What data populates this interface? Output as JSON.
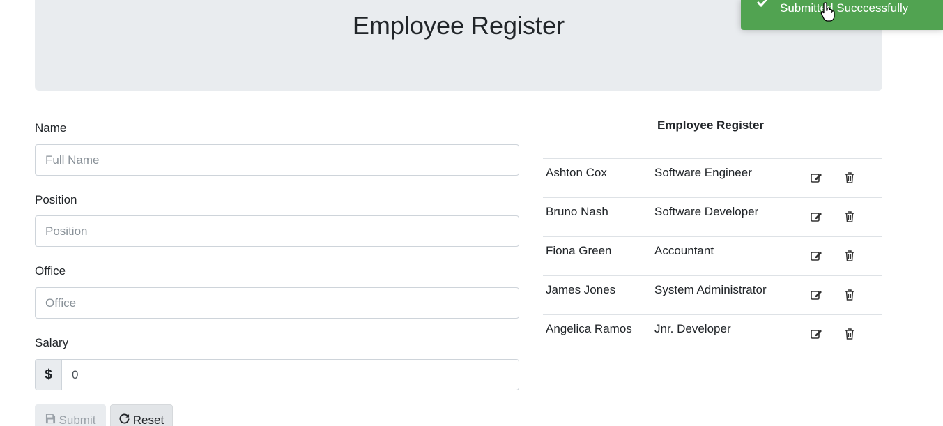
{
  "header": {
    "title": "Employee Register"
  },
  "form": {
    "name_label": "Name",
    "name_placeholder": "Full Name",
    "position_label": "Position",
    "position_placeholder": "Position",
    "office_label": "Office",
    "office_placeholder": "Office",
    "salary_label": "Salary",
    "salary_prefix": "$",
    "salary_value": "0",
    "submit_label": "Submit",
    "reset_label": "Reset"
  },
  "table": {
    "title": "Employee Register",
    "rows": [
      {
        "name": "Ashton Cox",
        "position": "Software Engineer"
      },
      {
        "name": "Bruno Nash",
        "position": "Software Developer"
      },
      {
        "name": "Fiona Green",
        "position": "Accountant"
      },
      {
        "name": "James Jones",
        "position": "System Administrator"
      },
      {
        "name": "Angelica Ramos",
        "position": "Jnr. Developer"
      }
    ]
  },
  "toast": {
    "message": "Submitted Succcessfully",
    "icon": "check-icon",
    "color": "#51a351"
  },
  "colors": {
    "jumbotron_bg": "#e9ecef",
    "text": "#212529"
  }
}
